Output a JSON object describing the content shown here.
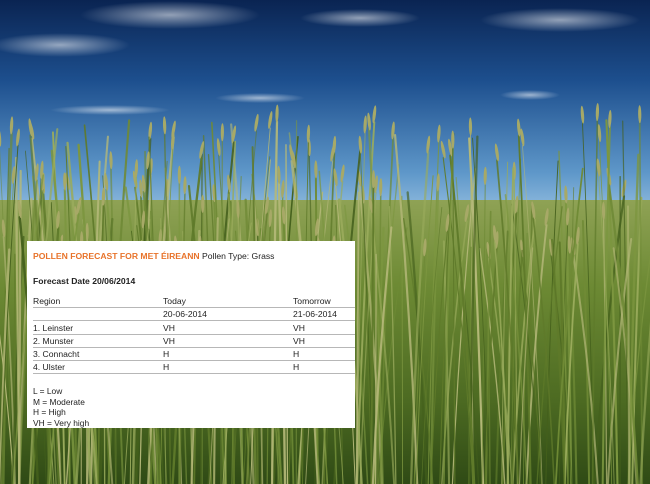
{
  "header": {
    "title": "POLLEN FORECAST FOR MET ÉIREANN",
    "pollen_type": "Pollen Type: Grass"
  },
  "forecast_date": "Forecast Date 20/06/2014",
  "table": {
    "headers": [
      "Region",
      "Today",
      "Tomorrow"
    ],
    "dates": [
      "",
      "20-06-2014",
      "21-06-2014"
    ],
    "rows": [
      [
        "1. Leinster",
        "VH",
        "VH"
      ],
      [
        "2. Munster",
        "VH",
        "VH"
      ],
      [
        "3. Connacht",
        "H",
        "H"
      ],
      [
        "4. Ulster",
        "H",
        "H"
      ]
    ]
  },
  "legend": [
    "L = Low",
    "M = Moderate",
    "H = High",
    "VH = Very high"
  ],
  "colors": {
    "title": "#e8732a",
    "sky_top": "#0b2a5e",
    "sky_horizon": "#9fc6e6",
    "grass_dark": "#2c4414",
    "grass_light": "#8aa44a"
  }
}
